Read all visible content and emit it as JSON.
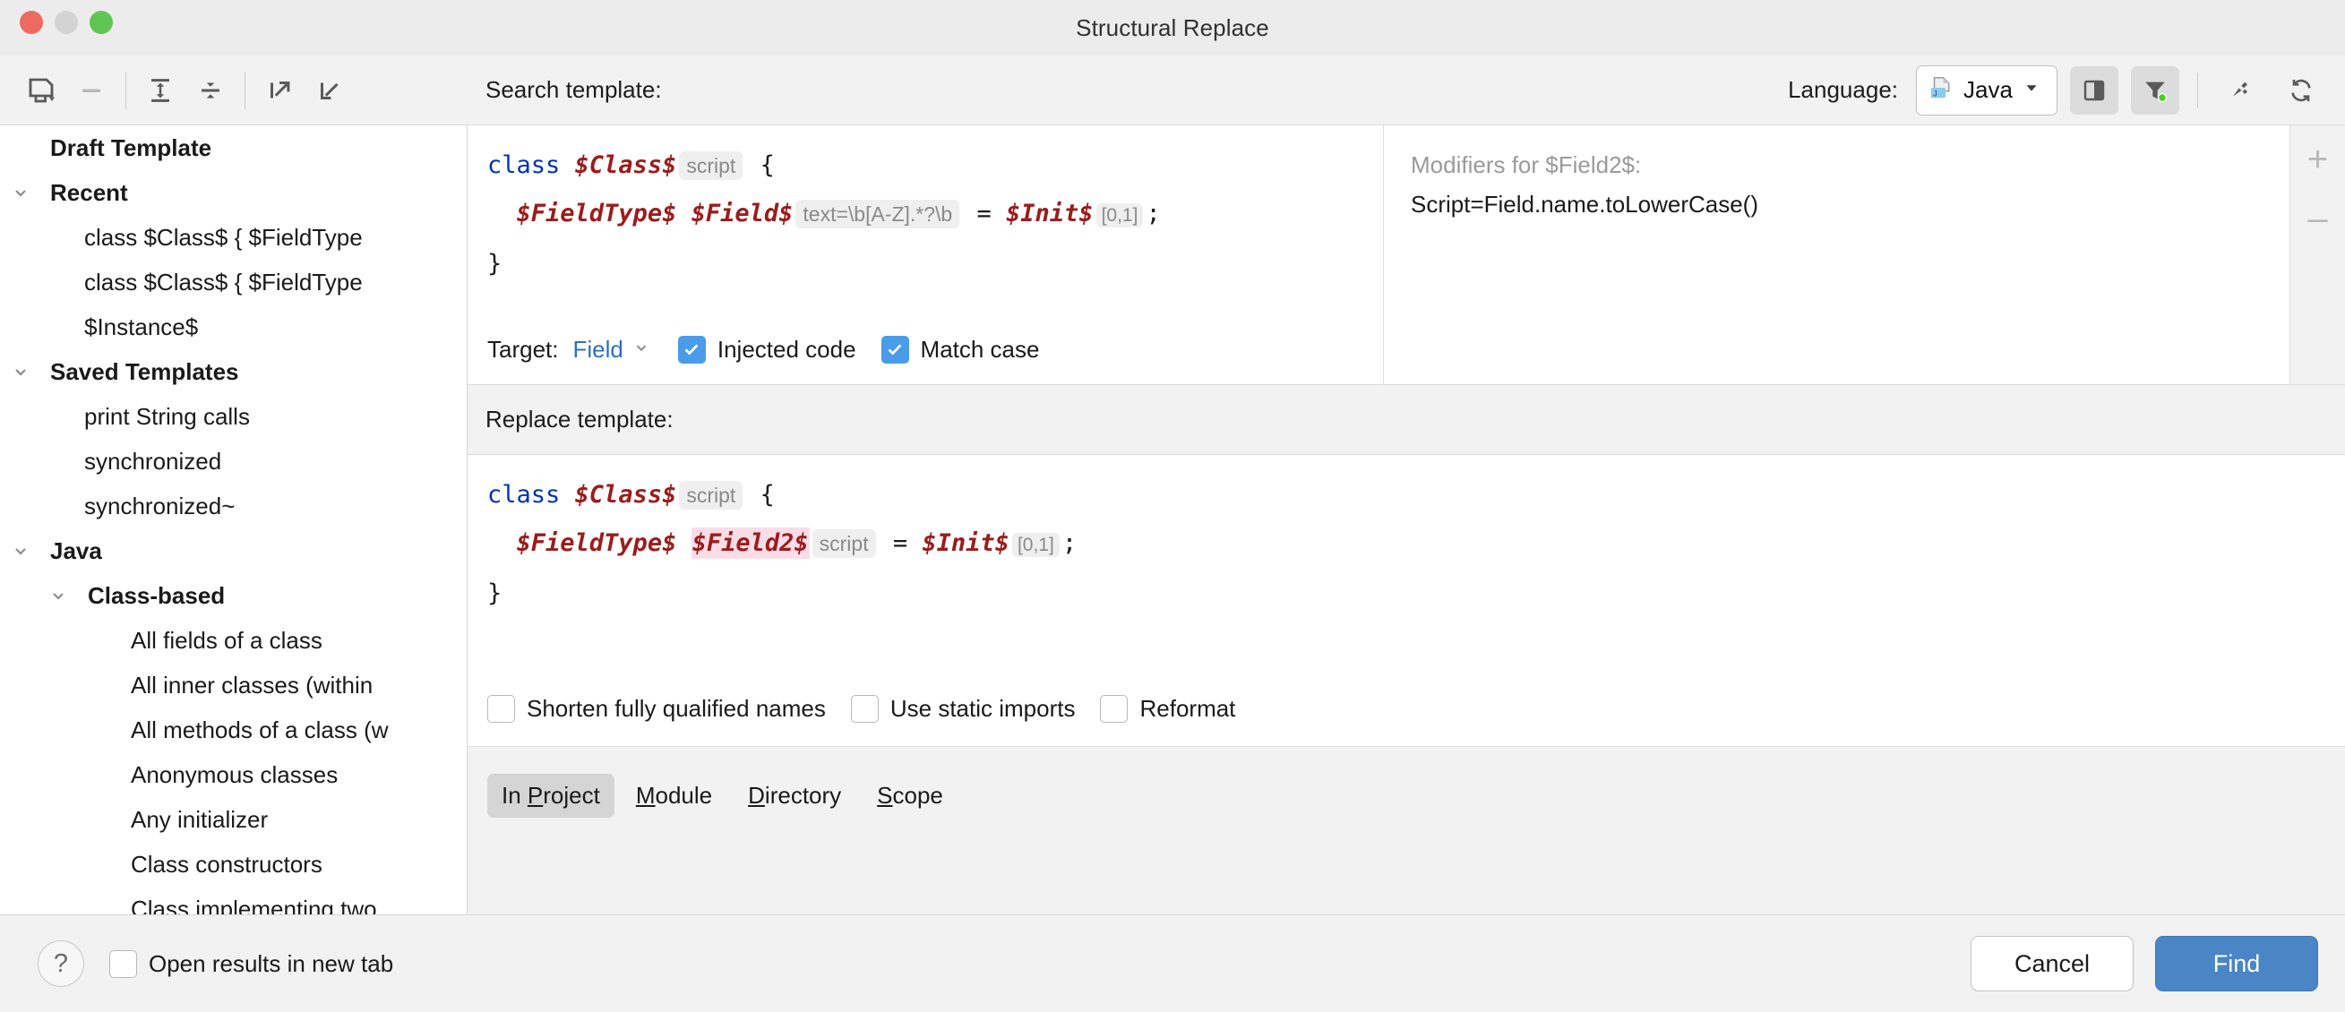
{
  "window": {
    "title": "Structural Replace"
  },
  "left_toolbar": {
    "buttons": [
      {
        "name": "save-template-icon",
        "tip": "Save template"
      },
      {
        "name": "remove-template-icon",
        "tip": "Remove template"
      },
      {
        "name": "expand-all-icon",
        "tip": "Expand all"
      },
      {
        "name": "collapse-all-icon",
        "tip": "Collapse all"
      },
      {
        "name": "export-template-icon",
        "tip": "Export template"
      },
      {
        "name": "import-template-icon",
        "tip": "Import template"
      }
    ]
  },
  "tree": {
    "items": [
      {
        "label": "Draft Template",
        "level": 0,
        "group": true,
        "chevron": "none"
      },
      {
        "label": "Recent",
        "level": 0,
        "group": true,
        "chevron": "down"
      },
      {
        "label": "class $Class$ {  $FieldType",
        "level": 1,
        "group": false,
        "chevron": "none"
      },
      {
        "label": "class $Class$ {  $FieldType",
        "level": 1,
        "group": false,
        "chevron": "none"
      },
      {
        "label": "$Instance$",
        "level": 1,
        "group": false,
        "chevron": "none"
      },
      {
        "label": "Saved Templates",
        "level": 0,
        "group": true,
        "chevron": "down"
      },
      {
        "label": "print String calls",
        "level": 1,
        "group": false,
        "chevron": "none"
      },
      {
        "label": "synchronized",
        "level": 1,
        "group": false,
        "chevron": "none"
      },
      {
        "label": "synchronized~",
        "level": 1,
        "group": false,
        "chevron": "none"
      },
      {
        "label": "Java",
        "level": 0,
        "group": true,
        "chevron": "down"
      },
      {
        "label": "Class-based",
        "level": 1,
        "group": true,
        "chevron": "down"
      },
      {
        "label": "All fields of a class",
        "level": 2,
        "group": false,
        "chevron": "none"
      },
      {
        "label": "All inner classes (within",
        "level": 2,
        "group": false,
        "chevron": "none"
      },
      {
        "label": "All methods of a class (w",
        "level": 2,
        "group": false,
        "chevron": "none"
      },
      {
        "label": "Anonymous classes",
        "level": 2,
        "group": false,
        "chevron": "none"
      },
      {
        "label": "Any initializer",
        "level": 2,
        "group": false,
        "chevron": "none"
      },
      {
        "label": "Class constructors",
        "level": 2,
        "group": false,
        "chevron": "none"
      },
      {
        "label": "Class implementing two",
        "level": 2,
        "group": false,
        "chevron": "none"
      }
    ]
  },
  "search": {
    "header_label": "Search template:",
    "language_label": "Language:",
    "language_value": "Java",
    "toolbar": {
      "layout_icon": "panel-layout-icon",
      "filter_icon": "filter-icon",
      "pin_icon": "pin-icon",
      "reload_icon": "reload-icon"
    },
    "code": {
      "line1": {
        "kw": "class",
        "var": "$Class$",
        "inlay": "script",
        "brace": "{"
      },
      "line2": {
        "type": "$FieldType$",
        "field": "$Field$",
        "inlay": "text=\\b[A-Z].*?\\b",
        "eq": "=",
        "init": "$Init$",
        "count": "[0,1]",
        "semi": ";"
      },
      "line3": "}"
    },
    "target_label": "Target:",
    "target_value": "Field",
    "checkboxes": [
      {
        "label": "Injected code",
        "checked": true
      },
      {
        "label": "Match case",
        "checked": true
      }
    ]
  },
  "modifiers": {
    "title": "Modifiers for $Field2$:",
    "body": "Script=Field.name.toLowerCase()",
    "add_label": "+",
    "remove_label": "–"
  },
  "replace": {
    "header_label": "Replace template:",
    "code": {
      "line1": {
        "kw": "class",
        "var": "$Class$",
        "inlay": "script",
        "brace": "{"
      },
      "line2": {
        "type": "$FieldType$",
        "field": "$Field2$",
        "inlay": "script",
        "eq": "=",
        "init": "$Init$",
        "count": "[0,1]",
        "semi": ";"
      },
      "line3": "}"
    },
    "options": [
      {
        "label": "Shorten fully qualified names",
        "checked": false
      },
      {
        "label": "Use static imports",
        "checked": false
      },
      {
        "label": "Reformat",
        "checked": false
      }
    ]
  },
  "scope": {
    "tabs": [
      {
        "pre": "In ",
        "mnemonic": "P",
        "post": "roject",
        "selected": true
      },
      {
        "pre": "",
        "mnemonic": "M",
        "post": "odule",
        "selected": false
      },
      {
        "pre": "",
        "mnemonic": "D",
        "post": "irectory",
        "selected": false
      },
      {
        "pre": "",
        "mnemonic": "S",
        "post": "cope",
        "selected": false
      }
    ]
  },
  "footer": {
    "help_label": "?",
    "open_results": {
      "label": "Open results in new tab",
      "checked": false
    },
    "cancel_label": "Cancel",
    "find_label": "Find"
  },
  "colors": {
    "accent": "#4a86c5",
    "checkbox_checked": "#4a9bea",
    "keyword": "#0033b3",
    "variable": "#9b1c1c",
    "variable_highlight_bg": "#fbdde8",
    "inlay_bg": "#efefef",
    "link": "#2f6fc4"
  }
}
